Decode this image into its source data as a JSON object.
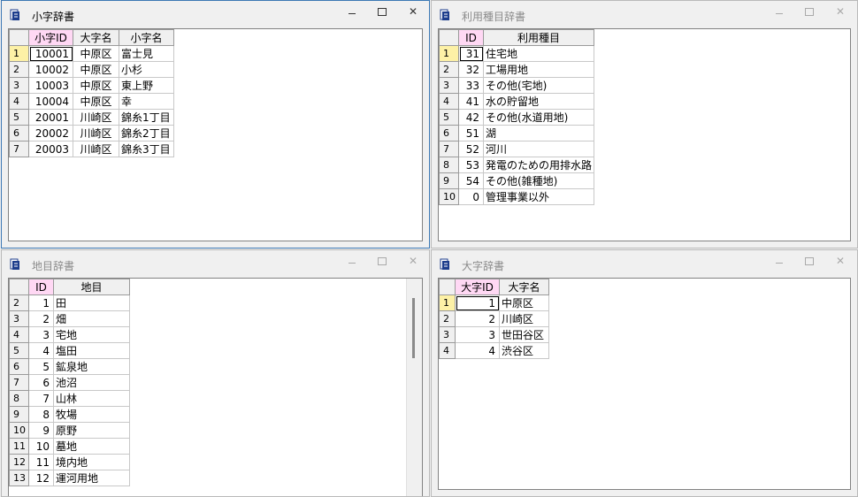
{
  "windows": {
    "koaza": {
      "title": "小字辞書",
      "columns": [
        "小字ID",
        "大字名",
        "小字名"
      ],
      "rows": [
        {
          "n": "1",
          "id": "10001",
          "oaza": "中原区",
          "koaza": "富士見"
        },
        {
          "n": "2",
          "id": "10002",
          "oaza": "中原区",
          "koaza": "小杉"
        },
        {
          "n": "3",
          "id": "10003",
          "oaza": "中原区",
          "koaza": "東上野"
        },
        {
          "n": "4",
          "id": "10004",
          "oaza": "中原区",
          "koaza": "幸"
        },
        {
          "n": "5",
          "id": "20001",
          "oaza": "川崎区",
          "koaza": "錦糸1丁目"
        },
        {
          "n": "6",
          "id": "20002",
          "oaza": "川崎区",
          "koaza": "錦糸2丁目"
        },
        {
          "n": "7",
          "id": "20003",
          "oaza": "川崎区",
          "koaza": "錦糸3丁目"
        }
      ]
    },
    "riyo": {
      "title": "利用種目辞書",
      "columns": [
        "ID",
        "利用種目"
      ],
      "rows": [
        {
          "n": "1",
          "id": "31",
          "name": "住宅地"
        },
        {
          "n": "2",
          "id": "32",
          "name": "工場用地"
        },
        {
          "n": "3",
          "id": "33",
          "name": "その他(宅地)"
        },
        {
          "n": "4",
          "id": "41",
          "name": "水の貯留地"
        },
        {
          "n": "5",
          "id": "42",
          "name": "その他(水道用地)"
        },
        {
          "n": "6",
          "id": "51",
          "name": "湖"
        },
        {
          "n": "7",
          "id": "52",
          "name": "河川"
        },
        {
          "n": "8",
          "id": "53",
          "name": "発電のための用排水路"
        },
        {
          "n": "9",
          "id": "54",
          "name": "その他(雑種地)"
        },
        {
          "n": "10",
          "id": "0",
          "name": "管理事業以外"
        }
      ]
    },
    "chimoku": {
      "title": "地目辞書",
      "columns": [
        "ID",
        "地目"
      ],
      "rows": [
        {
          "n": "2",
          "id": "1",
          "name": "田"
        },
        {
          "n": "3",
          "id": "2",
          "name": "畑"
        },
        {
          "n": "4",
          "id": "3",
          "name": "宅地"
        },
        {
          "n": "5",
          "id": "4",
          "name": "塩田"
        },
        {
          "n": "6",
          "id": "5",
          "name": "鉱泉地"
        },
        {
          "n": "7",
          "id": "6",
          "name": "池沼"
        },
        {
          "n": "8",
          "id": "7",
          "name": "山林"
        },
        {
          "n": "9",
          "id": "8",
          "name": "牧場"
        },
        {
          "n": "10",
          "id": "9",
          "name": "原野"
        },
        {
          "n": "11",
          "id": "10",
          "name": "墓地"
        },
        {
          "n": "12",
          "id": "11",
          "name": "境内地"
        },
        {
          "n": "13",
          "id": "12",
          "name": "運河用地"
        }
      ]
    },
    "oaza": {
      "title": "大字辞書",
      "columns": [
        "大字ID",
        "大字名"
      ],
      "rows": [
        {
          "n": "1",
          "id": "1",
          "name": "中原区"
        },
        {
          "n": "2",
          "id": "2",
          "name": "川崎区"
        },
        {
          "n": "3",
          "id": "3",
          "name": "世田谷区"
        },
        {
          "n": "4",
          "id": "4",
          "name": "渋谷区"
        }
      ]
    }
  },
  "controls": {
    "minimize": "minimize",
    "maximize": "maximize",
    "close": "✕"
  },
  "colors": {
    "key_header": "#ffd8f4",
    "current_row": "#fdf1a6",
    "active_border": "#3c78b4"
  }
}
